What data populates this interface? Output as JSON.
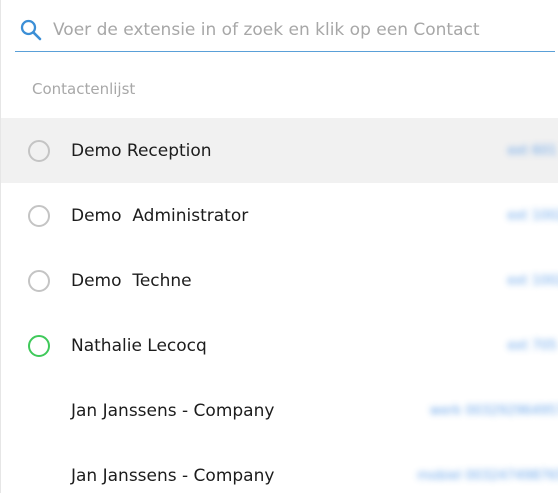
{
  "search": {
    "placeholder": "Voer de extensie in of zoek en klik op een Contact",
    "value": ""
  },
  "section": {
    "label": "Contactenlijst"
  },
  "contacts": [
    {
      "name": "Demo Reception",
      "ext": "ext 601",
      "status": "offline",
      "selected": true
    },
    {
      "name": "Demo  Administrator",
      "ext": "ext 1002",
      "status": "offline",
      "selected": false
    },
    {
      "name": "Demo  Techne",
      "ext": "ext 1002",
      "status": "offline",
      "selected": false
    },
    {
      "name": "Nathalie Lecocq",
      "ext": "ext 705",
      "status": "online",
      "selected": false
    },
    {
      "name": "Jan Janssens - Company",
      "ext": "werk 0032929649579",
      "status": "none",
      "selected": false
    },
    {
      "name": "Jan Janssens - Company",
      "ext": "mobiel 0032474987654",
      "status": "none",
      "selected": false
    }
  ],
  "colors": {
    "accent": "#5aa0d8",
    "online": "#3fc95a",
    "offline": "#c4c4c4",
    "selected_row": "#f1f1f1"
  }
}
